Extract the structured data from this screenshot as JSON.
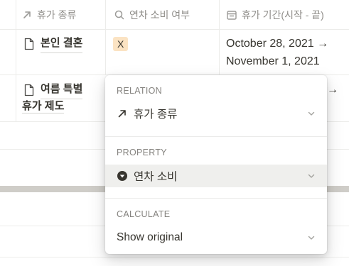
{
  "table": {
    "columns": [
      {
        "label": "휴가 종류",
        "icon": "arrow-up-right-icon"
      },
      {
        "label": "연차 소비 여부",
        "icon": "search-icon"
      },
      {
        "label": "휴가 기간(시작 - 끝)",
        "icon": "calendar-icon"
      }
    ],
    "rows": [
      {
        "title": "본인 결혼",
        "tag": "X",
        "date_line1": "October 28, 2021 →",
        "date_line2": "November 1, 2021"
      },
      {
        "title_line1": "여름 특별",
        "title_line2": "휴가 제도",
        "date_arrow": "→"
      }
    ]
  },
  "popup": {
    "relation": {
      "section_label": "RELATION",
      "value": "휴가 종류",
      "icon": "arrow-up-right-icon"
    },
    "property": {
      "section_label": "PROPERTY",
      "value": "연차 소비",
      "icon": "select-dropdown-icon"
    },
    "calculate": {
      "section_label": "CALCULATE",
      "value": "Show original"
    }
  },
  "colors": {
    "tag_background": "#fbe3c3",
    "text": "#37352f",
    "muted": "#8f8d89",
    "active_row": "#efefed"
  }
}
